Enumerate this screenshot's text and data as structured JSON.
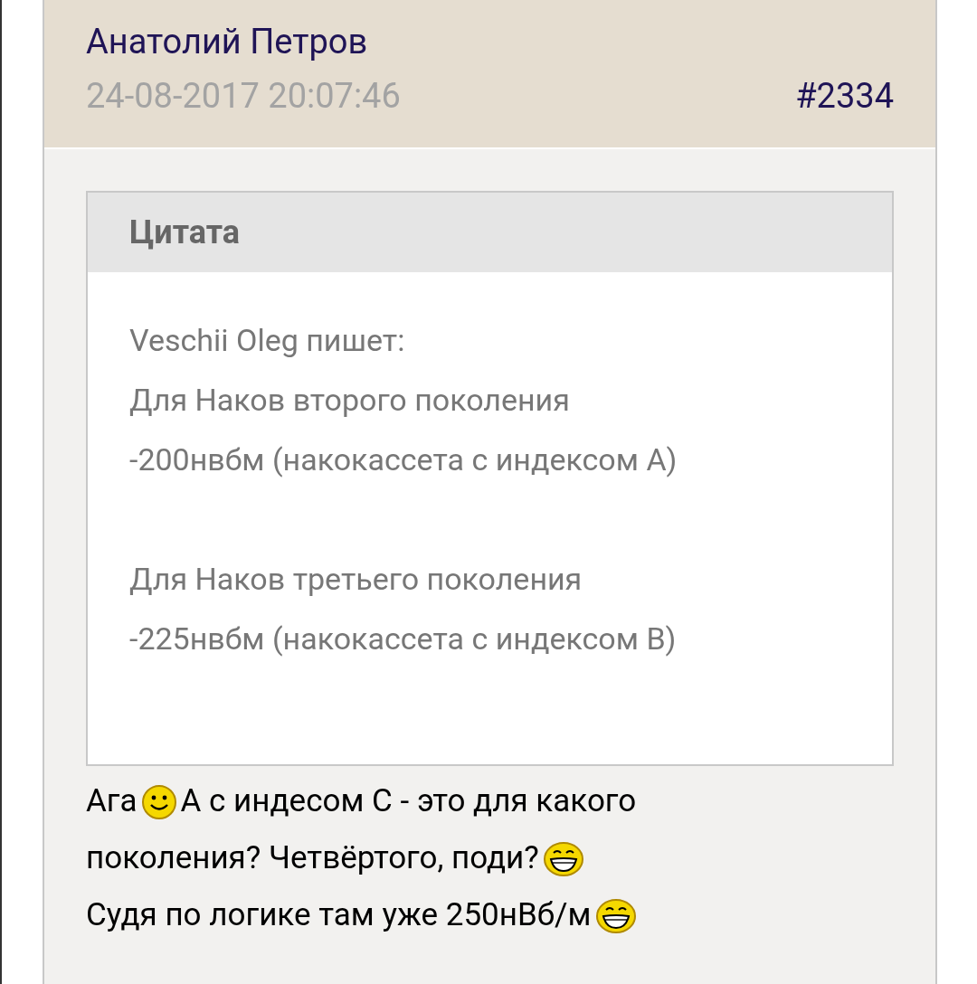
{
  "post": {
    "author": "Анатолий Петров",
    "datetime": "24-08-2017 20:07:46",
    "number": "#2334"
  },
  "quote": {
    "title": "Цитата",
    "paragraphs": [
      [
        "Veschii Oleg пишет:",
        "Для Наков второго поколения",
        "-200нвбм (накокассета с индексом А)"
      ],
      [
        "Для Наков третьего поколения",
        "-225нвбм (накокассета с индексом В)"
      ]
    ]
  },
  "reply": [
    [
      {
        "kind": "text",
        "text": "Ага"
      },
      {
        "kind": "smile"
      },
      {
        "kind": "text",
        "text": "А с индесом С - это для какого"
      }
    ],
    [
      {
        "kind": "text",
        "text": "поколения? Четвёртого, поди?"
      },
      {
        "kind": "grin"
      }
    ],
    [
      {
        "kind": "text",
        "text": "Судя по логике там уже 250нВб/м"
      },
      {
        "kind": "grin"
      }
    ]
  ]
}
